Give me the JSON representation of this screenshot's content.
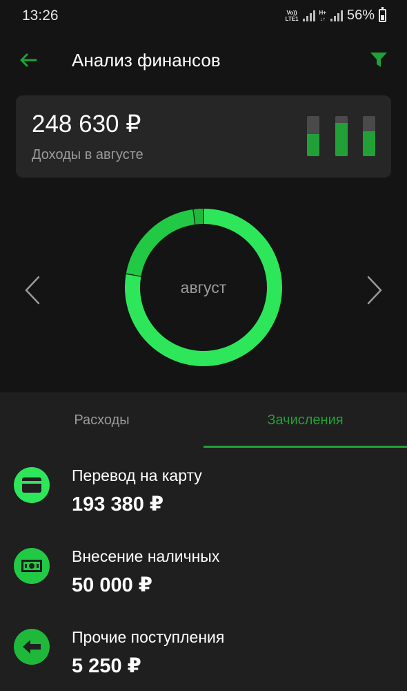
{
  "status_bar": {
    "time": "13:26",
    "network_1": [
      "Vo))",
      "LTE1"
    ],
    "network_2": [
      "H+",
      "↓↑"
    ],
    "battery": "56%",
    "battery_level": 0.56
  },
  "header": {
    "title": "Анализ финансов",
    "back_icon": "arrow-left-icon",
    "filter_icon": "funnel-icon"
  },
  "summary": {
    "amount": "248 630 ₽",
    "label": "Доходы в августе",
    "mini_bars": [
      0.55,
      0.82,
      0.62
    ]
  },
  "chart": {
    "center_label": "август",
    "prev_icon": "chevron-left-icon",
    "next_icon": "chevron-right-icon"
  },
  "chart_data": {
    "type": "pie",
    "title": "",
    "center_label": "август",
    "categories": [
      "Перевод на карту",
      "Внесение наличных",
      "Прочие поступления"
    ],
    "values": [
      193380,
      50000,
      5250
    ],
    "colors": [
      "#2ee65a",
      "#22c944",
      "#1fb83b"
    ]
  },
  "tabs": [
    {
      "label": "Расходы",
      "active": false
    },
    {
      "label": "Зачисления",
      "active": true
    }
  ],
  "items": [
    {
      "name": "Перевод на карту",
      "amount": "193 380 ₽",
      "icon": "card-icon",
      "icon_bg": "#2ee65a"
    },
    {
      "name": "Внесение наличных",
      "amount": "50 000 ₽",
      "icon": "cash-icon",
      "icon_bg": "#22c944"
    },
    {
      "name": "Прочие поступления",
      "amount": "5 250 ₽",
      "icon": "arrow-left-filled-icon",
      "icon_bg": "#1fb83b"
    }
  ],
  "colors": {
    "accent": "#21a038",
    "background": "#141414",
    "card": "#262626",
    "list_bg": "#1f1f1f",
    "muted_text": "#9a9a9a"
  }
}
